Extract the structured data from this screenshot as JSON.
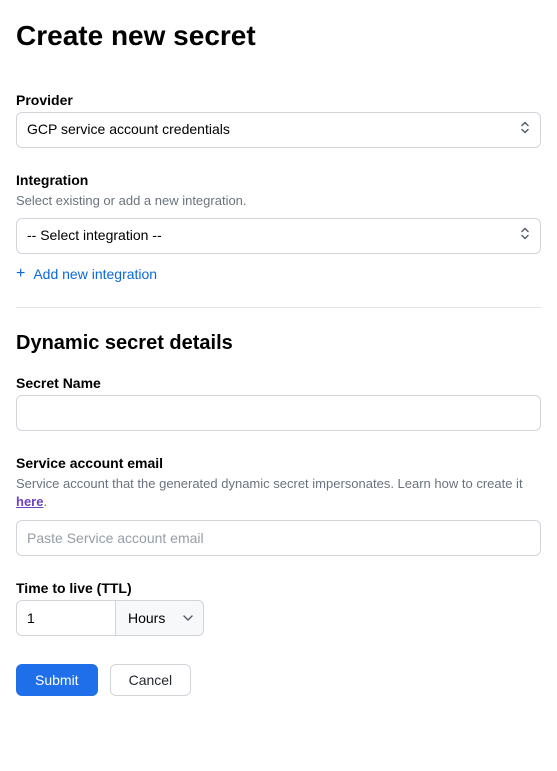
{
  "page_title": "Create new secret",
  "provider": {
    "label": "Provider",
    "value": "GCP service account credentials"
  },
  "integration": {
    "label": "Integration",
    "help": "Select existing or add a new integration.",
    "value": "-- Select integration --",
    "add_label": "Add new integration"
  },
  "details": {
    "heading": "Dynamic secret details",
    "secret_name": {
      "label": "Secret Name",
      "value": ""
    },
    "service_account": {
      "label": "Service account email",
      "help_prefix": "Service account that the generated dynamic secret impersonates. Learn how to create it ",
      "help_link": "here",
      "help_suffix": ".",
      "placeholder": "Paste Service account email",
      "value": ""
    },
    "ttl": {
      "label": "Time to live (TTL)",
      "value": "1",
      "unit": "Hours"
    }
  },
  "actions": {
    "submit": "Submit",
    "cancel": "Cancel"
  }
}
